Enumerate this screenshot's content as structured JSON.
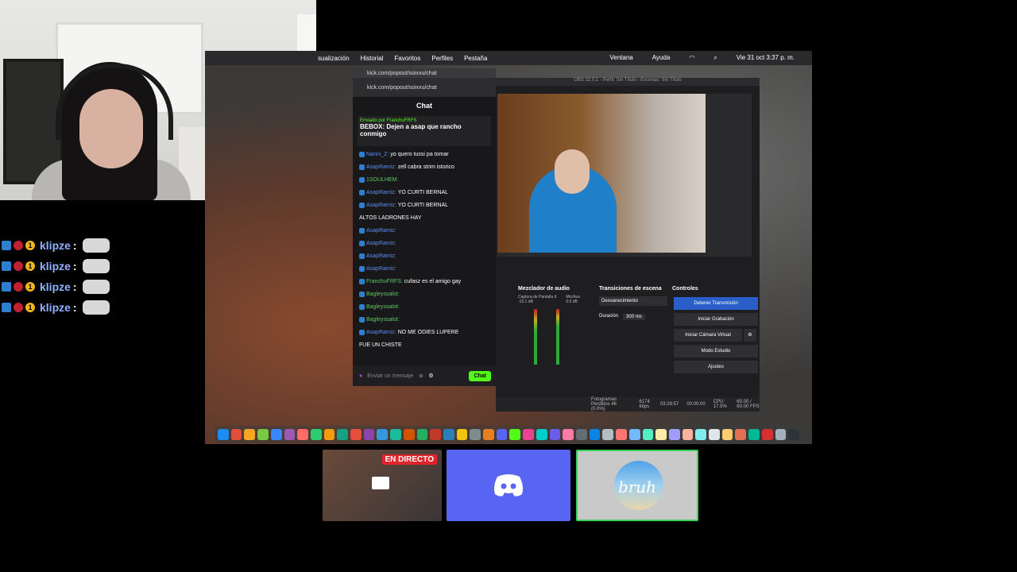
{
  "overlay_chat": {
    "rows": [
      {
        "user": "klipze",
        "sep": ":"
      },
      {
        "user": "klipze",
        "sep": ":"
      },
      {
        "user": "klipze",
        "sep": ":"
      },
      {
        "user": "klipze",
        "sep": ":"
      }
    ]
  },
  "menubar": {
    "items": [
      "sualización",
      "Historial",
      "Favoritos",
      "Perfiles",
      "Pestaña"
    ],
    "right": [
      "Ventana",
      "Ayuda"
    ],
    "clock": "Vie 31 oct  3:37 p. m."
  },
  "chat_window": {
    "tab_url": "kick.com/popout/soixxu/chat",
    "url": "kick.com/popout/soixxu/chat",
    "title": "Chat",
    "pinned_by": "Enviado por FranchuFRFS",
    "pinned_text": "BEBOX: Dejen a asap que rancho conmigo",
    "messages": [
      {
        "user": "Nanni_Z:",
        "text": "yo quero tussi pa tomar",
        "green": false
      },
      {
        "user": "AsapRamiz:",
        "text": "zell cabra strim istorico",
        "green": false
      },
      {
        "user": "1SOULHEM:",
        "text": "",
        "green": true
      },
      {
        "user": "AsapRamiz:",
        "text": "YO CURTI BERNAL",
        "green": false
      },
      {
        "user": "AsapRamiz:",
        "text": "YO CURTI BERNAL",
        "green": false
      },
      {
        "user": "",
        "text": "ALTOS LADRONES HAY",
        "green": false
      },
      {
        "user": "AsapRamiz:",
        "text": "",
        "green": false
      },
      {
        "user": "AsapRamiz:",
        "text": "",
        "green": false
      },
      {
        "user": "AsapRamiz:",
        "text": "",
        "green": false
      },
      {
        "user": "AsapRamiz:",
        "text": "",
        "green": false
      },
      {
        "user": "FranchuFRFS:",
        "text": "cufasz es el amigo gay",
        "green": true
      },
      {
        "user": "Bagleyssalot:",
        "text": "",
        "green": true
      },
      {
        "user": "Bagleyssalot:",
        "text": "",
        "green": true
      },
      {
        "user": "Bagleyssalot:",
        "text": "",
        "green": true
      },
      {
        "user": "AsapRamiz:",
        "text": "NO ME ODIES LUPERE",
        "green": false
      },
      {
        "user": "",
        "text": "FUE UN CHISTE",
        "green": false
      }
    ],
    "input_placeholder": "Enviar un mensaje",
    "chat_button": "Chat"
  },
  "obs": {
    "window_title": "OBS 32.0.1 - Perfil: Sin Título - Escenas: Sin Título",
    "mixer_title": "Mezclador de audio",
    "mixer_channels": [
      {
        "name": "Captura de Pantalla d",
        "db": "-15.1 dB"
      },
      {
        "name": "Mic/Aux",
        "db": "0.0 dB"
      }
    ],
    "transitions_title": "Transiciones de escena",
    "transition_value": "Desvanecimiento",
    "duration_label": "Duración",
    "duration_value": "300 ms",
    "controls_title": "Controles",
    "controls": [
      "Detener Transmisión",
      "Iniciar Grabación",
      "Iniciar Cámara Virtual",
      "Modo Estudio",
      "Ajustes"
    ],
    "status": {
      "dropped": "Fotogramas Perdidos 46 (0.0%)",
      "bitrate": "6174 kbps",
      "live_time": "03:28:57",
      "rec_time": "00:00:00",
      "cpu": "CPU: 17.5%",
      "fps": "60.00 / 60.00 FPS"
    }
  },
  "bottom_cards": {
    "live_badge": "EN DIRECTO",
    "bruh_label": "bruh"
  },
  "colors": {
    "kick_green": "#53fc18",
    "discord": "#5865f2",
    "live_red": "#e0242b",
    "obs_active": "#2a5fc9"
  }
}
